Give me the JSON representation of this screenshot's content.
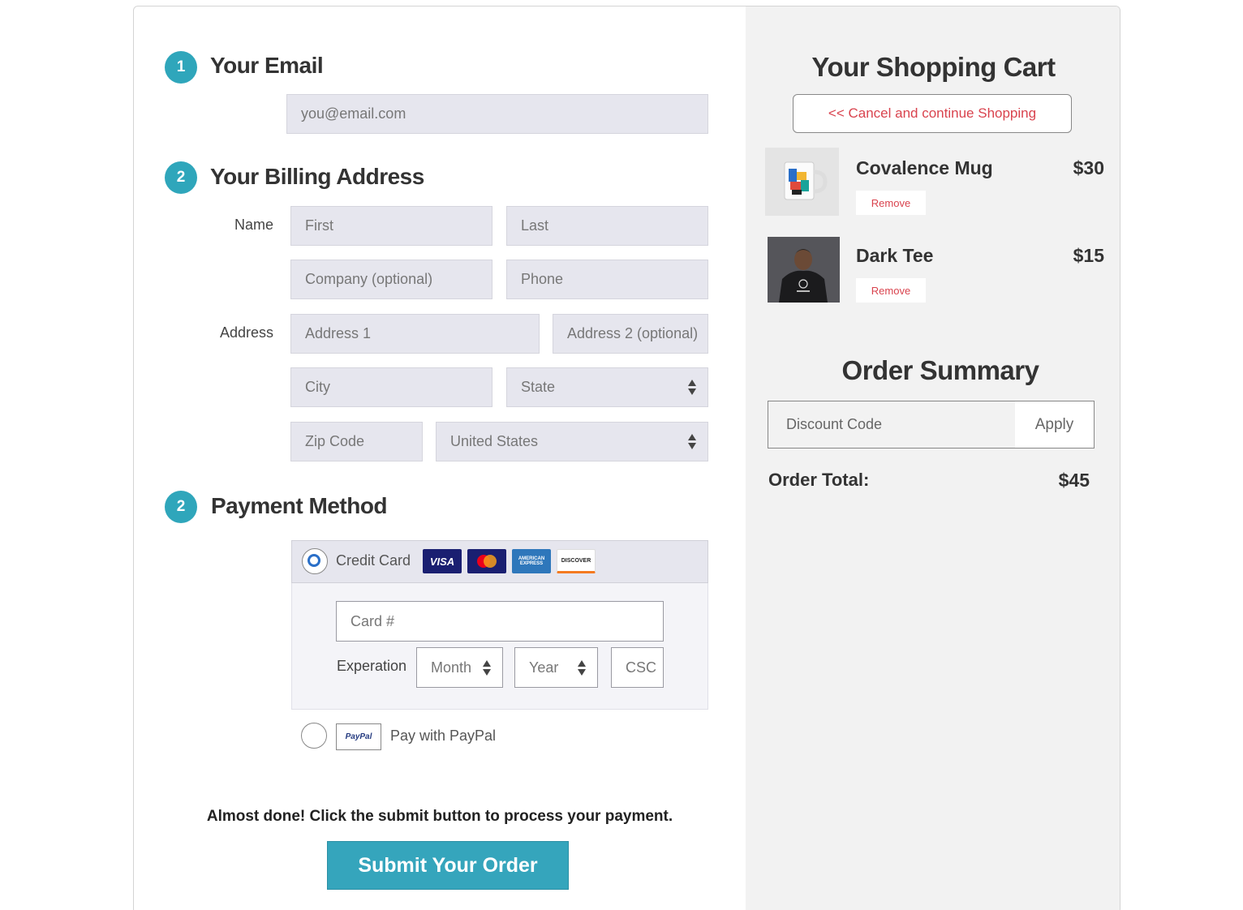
{
  "steps": {
    "email": {
      "number": "1",
      "title": "Your Email",
      "placeholder": "you@email.com"
    },
    "billing": {
      "number": "2",
      "title": "Your Billing Address",
      "name_label": "Name",
      "address_label": "Address",
      "first_placeholder": "First",
      "last_placeholder": "Last",
      "company_placeholder": "Company (optional)",
      "phone_placeholder": "Phone",
      "address1_placeholder": "Address 1",
      "address2_placeholder": "Address 2 (optional)",
      "city_placeholder": "City",
      "state_value": "State",
      "zip_placeholder": "Zip Code",
      "country_value": "United States"
    },
    "payment": {
      "number": "2",
      "title": "Payment Method",
      "credit_card_label": "Credit Card",
      "card_logos": [
        "VISA",
        "MasterCard",
        "AMERICAN EXPRESS",
        "DISCOVER"
      ],
      "card_number_placeholder": "Card #",
      "expiration_label": "Experation",
      "month_value": "Month",
      "year_value": "Year",
      "csc_placeholder": "CSC",
      "paypal_logo": "PayPal",
      "paypal_label": "Pay with PayPal"
    }
  },
  "submit": {
    "notice": "Almost done! Click the submit button to process your payment.",
    "button_label": "Submit Your Order"
  },
  "cart": {
    "title": "Your Shopping Cart",
    "cancel_label": "<< Cancel and continue Shopping",
    "items": [
      {
        "name": "Covalence Mug",
        "price": "$30",
        "remove_label": "Remove"
      },
      {
        "name": "Dark Tee",
        "price": "$15",
        "remove_label": "Remove"
      }
    ]
  },
  "summary": {
    "title": "Order Summary",
    "discount_placeholder": "Discount Code",
    "apply_label": "Apply",
    "total_label": "Order Total:",
    "total_value": "$45"
  },
  "colors": {
    "accent": "#35a5bc",
    "link_red": "#d9434e",
    "field_bg": "#e6e6ee",
    "panel_bg": "#f2f2f2"
  }
}
